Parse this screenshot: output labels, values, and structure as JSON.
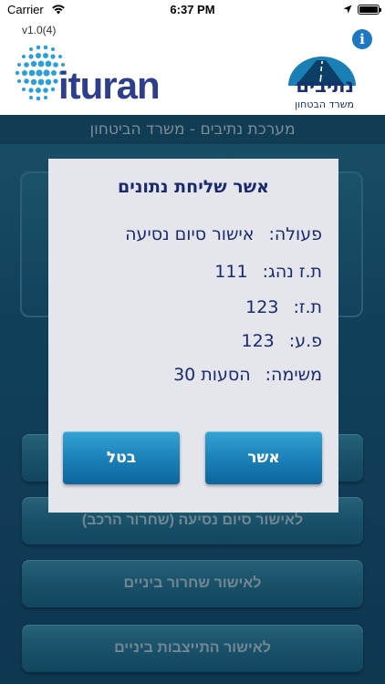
{
  "status_bar": {
    "carrier": "Carrier",
    "time": "6:37 PM",
    "icons": [
      "wifi-icon",
      "location-icon",
      "battery-icon"
    ]
  },
  "header": {
    "version": "v1.0(4)",
    "brand": "ituran",
    "netivim_title": "נתיבים",
    "netivim_subtitle": "משרד הבטחון",
    "info_icon": "i"
  },
  "system_bar": {
    "title": "מערכת נתיבים - משרד הביטחון"
  },
  "buttons": {
    "trip_end_release": "לאישור סיום נסיעה (שחרור הרכב)",
    "interim_release": "לאישור שחרור ביניים",
    "interim_positioning": "לאישור התייצבות ביניים"
  },
  "dialog": {
    "title": "אשר שליחת נתונים",
    "fields": [
      {
        "label": "פעולה:",
        "value": "אישור סיום נסיעה"
      },
      {
        "label": "ת.ז נהג:",
        "value": "111"
      },
      {
        "label": "ת.ז:",
        "value": "123"
      },
      {
        "label": "פ.ע:",
        "value": "123"
      },
      {
        "label": "משימה:",
        "value": "הסעות 30"
      }
    ],
    "confirm_label": "אשר",
    "cancel_label": "בטל"
  },
  "colors": {
    "brand_navy": "#2f3d8d",
    "info_blue": "#1d78c1",
    "dialog_text": "#1b2a6e",
    "dialog_button": "#1c82ba",
    "main_background": "#1c5f80"
  }
}
